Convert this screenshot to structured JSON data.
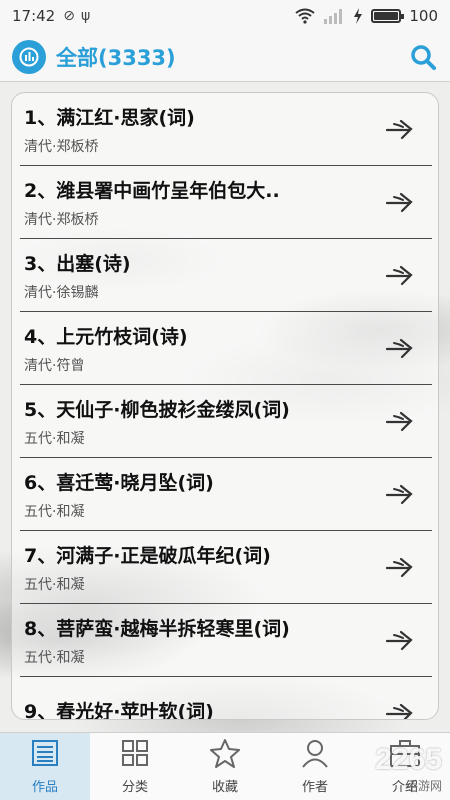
{
  "status_bar": {
    "time": "17:42",
    "battery_level": "100",
    "battery_fraction": 1.0
  },
  "header": {
    "title": "全部(3333)",
    "left_icon": "stats-icon",
    "right_icon": "search-icon"
  },
  "list": [
    {
      "poem": "1、满江红·思家(词)",
      "author": "清代·郑板桥"
    },
    {
      "poem": "2、潍县署中画竹呈年伯包大..",
      "author": "清代·郑板桥"
    },
    {
      "poem": "3、出塞(诗)",
      "author": "清代·徐锡麟"
    },
    {
      "poem": "4、上元竹枝词(诗)",
      "author": "清代·符曾"
    },
    {
      "poem": "5、天仙子·柳色披衫金缕凤(词)",
      "author": "五代·和凝"
    },
    {
      "poem": "6、喜迁莺·晓月坠(词)",
      "author": "五代·和凝"
    },
    {
      "poem": "7、河满子·正是破瓜年纪(词)",
      "author": "五代·和凝"
    },
    {
      "poem": "8、菩萨蛮·越梅半拆轻寒里(词)",
      "author": "五代·和凝"
    },
    {
      "poem": "9、春光好·苹叶软(词)",
      "author": ""
    }
  ],
  "nav": [
    {
      "label": "作品",
      "icon": "list-icon",
      "active": true
    },
    {
      "label": "分类",
      "icon": "grid-icon",
      "active": false
    },
    {
      "label": "收藏",
      "icon": "star-icon",
      "active": false
    },
    {
      "label": "作者",
      "icon": "person-icon",
      "active": false
    },
    {
      "label": "介绍",
      "icon": "briefcase-icon",
      "active": false
    }
  ],
  "watermark": {
    "text": "2265",
    "sub": "手游网"
  },
  "colors": {
    "accent": "#2a9fd8",
    "active_tab_bg": "#d7e8f3"
  }
}
